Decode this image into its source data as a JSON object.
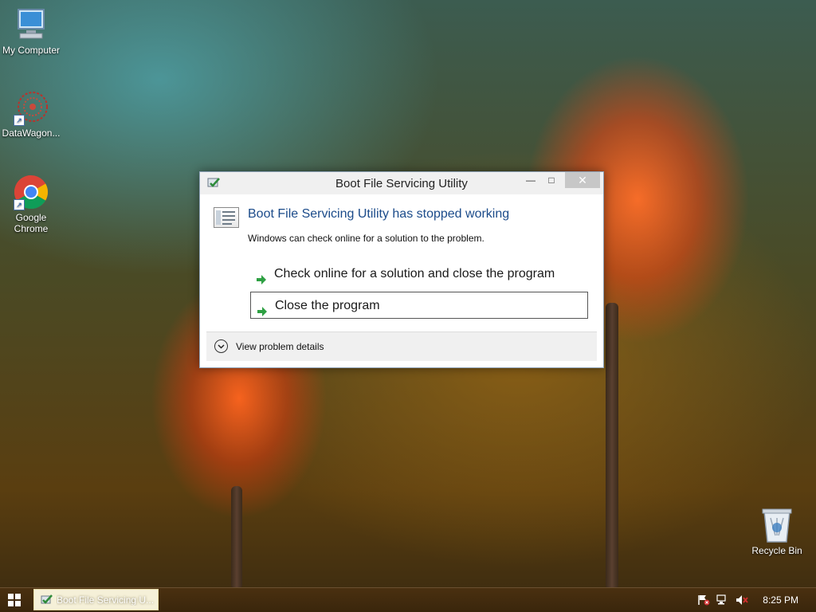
{
  "desktop": {
    "icons": [
      {
        "label": "My Computer"
      },
      {
        "label": "DataWagon..."
      },
      {
        "label": "Google\nChrome"
      },
      {
        "label": "Recycle Bin"
      }
    ]
  },
  "dialog": {
    "title": "Boot File Servicing Utility",
    "heading": "Boot File Servicing Utility has stopped working",
    "subtext": "Windows can check online for a solution to the problem.",
    "options": [
      {
        "label": "Check online for a solution and close the program"
      },
      {
        "label": "Close the program"
      }
    ],
    "details_label": "View problem details",
    "window_buttons": {
      "minimize": "—",
      "maximize": "□",
      "close": "✕"
    }
  },
  "taskbar": {
    "task_label": "Boot File Servicing U...",
    "clock": "8:25 PM"
  },
  "colors": {
    "heading": "#1b4b8a",
    "arrow": "#2ea043"
  }
}
